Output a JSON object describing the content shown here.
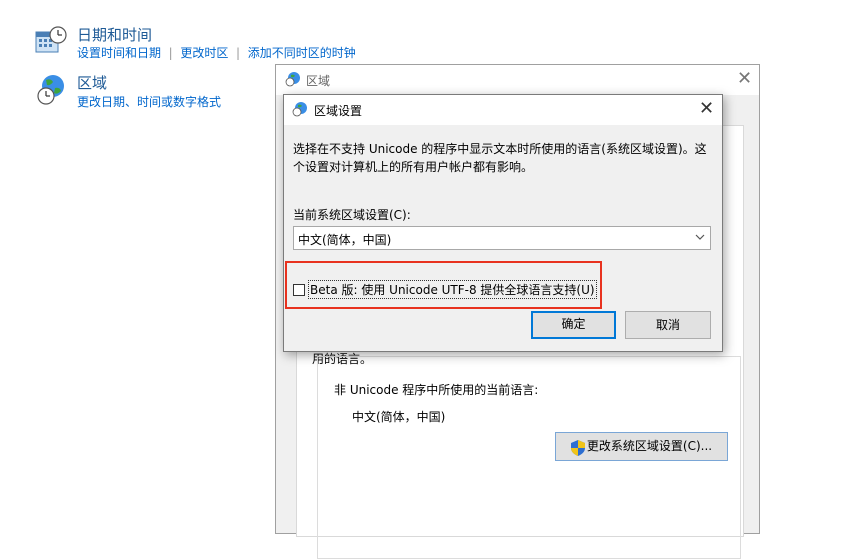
{
  "control_panel": {
    "datetime": {
      "title": "日期和时间",
      "links": [
        "设置时间和日期",
        "更改时区",
        "添加不同时区的时钟"
      ]
    },
    "region": {
      "title": "区域",
      "link": "更改日期、时间或数字格式"
    }
  },
  "region_window": {
    "title": "区域",
    "partial_text": "用的语言。",
    "nonunicode_label": "非 Unicode 程序中所使用的当前语言:",
    "current_language": "中文(简体，中国)",
    "change_button": "更改系统区域设置(C)..."
  },
  "dialog": {
    "title": "区域设置",
    "description": "选择在不支持 Unicode 的程序中显示文本时所使用的语言(系统区域设置)。这个设置对计算机上的所有用户帐户都有影响。",
    "current_label": "当前系统区域设置(C):",
    "selected_locale": "中文(简体，中国)",
    "beta_checkbox_label": "Beta 版: 使用 Unicode UTF-8 提供全球语言支持(U)",
    "beta_checked": false,
    "ok_button": "确定",
    "cancel_button": "取消"
  },
  "highlight_color": "#e8321f"
}
